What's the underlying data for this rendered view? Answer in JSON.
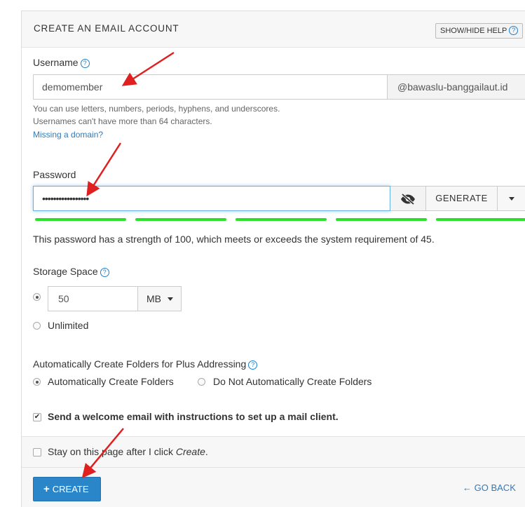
{
  "panel": {
    "title": "CREATE AN EMAIL ACCOUNT",
    "help_button": "SHOW/HIDE HELP",
    "help_icon": "?"
  },
  "username": {
    "label": "Username",
    "value": "demomember",
    "domain": "@bawaslu-banggailaut.id",
    "help_line1": "You can use letters, numbers, periods, hyphens, and underscores.",
    "help_line2": "Usernames can't have more than 64 characters.",
    "missing_domain_link": "Missing a domain?"
  },
  "password": {
    "label": "Password",
    "value": "•••••••••••••••••",
    "eye_icon": "eye-slash-icon",
    "generate_label": "GENERATE",
    "strength_percent": 100,
    "strength_color": "#2be02b",
    "strength_text": "This password has a strength of 100, which meets or exceeds the system requirement of 45."
  },
  "storage": {
    "label": "Storage Space",
    "value": "50",
    "unit": "MB",
    "unlimited_label": "Unlimited",
    "selected": "limited"
  },
  "plus_addressing": {
    "label": "Automatically Create Folders for Plus Addressing",
    "option_auto": "Automatically Create Folders",
    "option_manual": "Do Not Automatically Create Folders",
    "selected": "auto"
  },
  "welcome_email": {
    "label": "Send a welcome email with instructions to set up a mail client.",
    "checked": true
  },
  "stay_on_page": {
    "label_prefix": "Stay on this page after I click ",
    "label_emphasis": "Create",
    "label_suffix": ".",
    "checked": false
  },
  "actions": {
    "create_label": "CREATE",
    "create_icon": "+",
    "go_back_label": "GO BACK",
    "go_back_icon": "←"
  },
  "annotation_color": "#e02020"
}
